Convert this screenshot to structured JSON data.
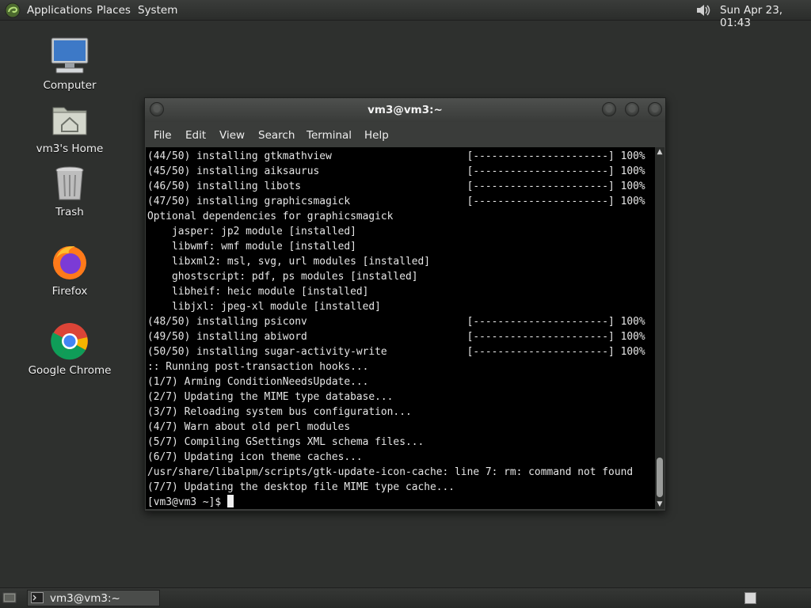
{
  "top_panel": {
    "menus": [
      "Applications",
      "Places",
      "System"
    ],
    "clock": "Sun Apr 23, 01:43"
  },
  "desktop": {
    "icons": [
      {
        "label": "Computer",
        "icon": "computer-icon"
      },
      {
        "label": "vm3's Home",
        "icon": "home-folder-icon"
      },
      {
        "label": "Trash",
        "icon": "trash-icon"
      },
      {
        "label": "Firefox",
        "icon": "firefox-icon"
      },
      {
        "label": "Google Chrome",
        "icon": "chrome-icon"
      }
    ]
  },
  "window": {
    "title": "vm3@vm3:~",
    "menu": [
      "File",
      "Edit",
      "View",
      "Search",
      "Terminal",
      "Help"
    ],
    "lines": [
      "(44/50) installing gtkmathview                      [----------------------] 100%",
      "(45/50) installing aiksaurus                        [----------------------] 100%",
      "(46/50) installing libots                           [----------------------] 100%",
      "(47/50) installing graphicsmagick                   [----------------------] 100%",
      "Optional dependencies for graphicsmagick",
      "    jasper: jp2 module [installed]",
      "    libwmf: wmf module [installed]",
      "    libxml2: msl, svg, url modules [installed]",
      "    ghostscript: pdf, ps modules [installed]",
      "    libheif: heic module [installed]",
      "    libjxl: jpeg-xl module [installed]",
      "(48/50) installing psiconv                          [----------------------] 100%",
      "(49/50) installing abiword                          [----------------------] 100%",
      "(50/50) installing sugar-activity-write             [----------------------] 100%",
      ":: Running post-transaction hooks...",
      "(1/7) Arming ConditionNeedsUpdate...",
      "(2/7) Updating the MIME type database...",
      "(3/7) Reloading system bus configuration...",
      "(4/7) Warn about old perl modules",
      "(5/7) Compiling GSettings XML schema files...",
      "(6/7) Updating icon theme caches...",
      "/usr/share/libalpm/scripts/gtk-update-icon-cache: line 7: rm: command not found",
      "(7/7) Updating the desktop file MIME type cache..."
    ],
    "prompt": "[vm3@vm3 ~]$ "
  },
  "taskbar": {
    "tasks": [
      {
        "label": "vm3@vm3:~",
        "icon": "terminal-icon"
      }
    ]
  },
  "colors": {
    "panel": "#2b2d2b",
    "desktop": "#2e302e",
    "terminal_bg": "#000000",
    "terminal_fg": "#e6e6e6"
  }
}
